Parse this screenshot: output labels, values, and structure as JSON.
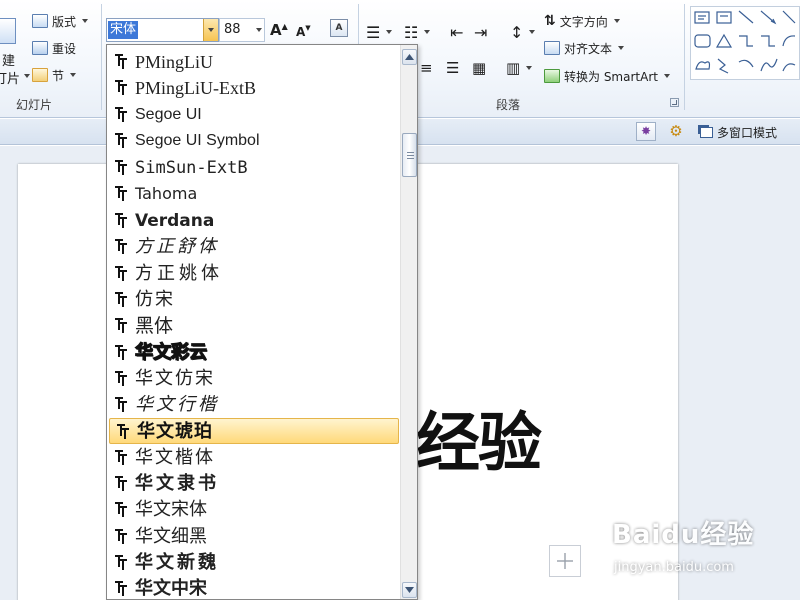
{
  "ribbon": {
    "slides_group": {
      "new_label_partial": "建",
      "slide_label_partial": "灯片",
      "layout_label": "版式",
      "reset_label": "重设",
      "section_label": "节",
      "group_label": "幻灯片"
    },
    "font": {
      "current_font": "宋体",
      "current_size": "88",
      "grow_icon": "A",
      "shrink_icon": "A"
    },
    "paragraph": {
      "group_label": "段落",
      "text_direction_label": "文字方向",
      "align_text_label": "对齐文本",
      "smartart_label": "转换为 SmartArt"
    }
  },
  "toolbar_strip": {
    "multiwindow_label": "多窗口模式"
  },
  "slide": {
    "visible_text": "经验"
  },
  "font_dropdown": {
    "items": [
      {
        "label": "PMingLiU"
      },
      {
        "label": "PMingLiU-ExtB"
      },
      {
        "label": "Segoe UI"
      },
      {
        "label": "Segoe UI Symbol"
      },
      {
        "label": "SimSun-ExtB"
      },
      {
        "label": "Tahoma"
      },
      {
        "label": "Verdana"
      },
      {
        "label": "方正舒体"
      },
      {
        "label": "方正姚体"
      },
      {
        "label": "仿宋"
      },
      {
        "label": "黑体"
      },
      {
        "label": "华文彩云"
      },
      {
        "label": "华文仿宋"
      },
      {
        "label": "华文行楷"
      },
      {
        "label": "华文琥珀",
        "selected": true
      },
      {
        "label": "华文楷体"
      },
      {
        "label": "华文隶书"
      },
      {
        "label": "华文宋体"
      },
      {
        "label": "华文细黑"
      },
      {
        "label": "华文新魏"
      },
      {
        "label": "华文中宋"
      }
    ]
  },
  "watermark": {
    "main": "Baidu经验",
    "sub": "jingyan.baidu.com"
  },
  "colors": {
    "selection_highlight": "#ffd97a",
    "combo_highlight": "#3d78d8",
    "ribbon_bg": "#f3f7fc"
  }
}
